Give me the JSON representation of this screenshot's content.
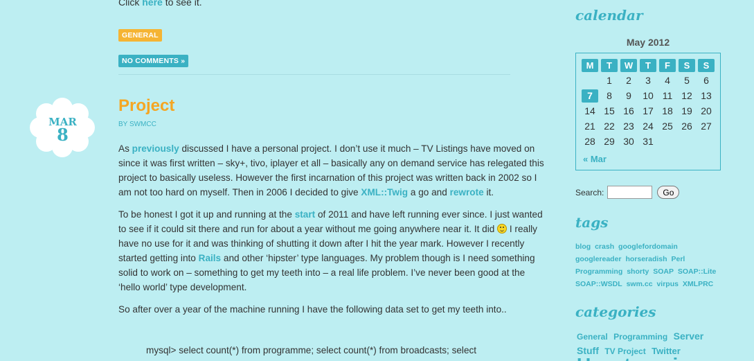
{
  "previous_post": {
    "click_prefix": "Click",
    "click_link": "here",
    "click_suffix": "to see it.",
    "category": "GENERAL",
    "comments": "NO COMMENTS »"
  },
  "post": {
    "date_month": "MAR",
    "date_day": "8",
    "title": "Project",
    "byline": "BY SWMCC",
    "p1": {
      "t1": "As",
      "l1": "previously",
      "t2": "discussed I have a personal project. I don’t use it much – TV Listings have moved on since it was first written – sky+, tivo, iplayer et all – basically any on demand service has relegated this project to basically useless. However the first incarnation of this project was written back in 2002 so I am not too hard on myself. Then in 2006 I decided to give",
      "l2": "XML::Twig",
      "t3": "a go and",
      "l3": "rewrote",
      "t4": "it."
    },
    "p2": {
      "t1": "To be honest I got it up and running at the",
      "l1": "start",
      "t2": "of 2011 and have left running ever since. I just wanted to see if it could sit there and run for about a year without me going anywhere near it. It did",
      "t3": "I really have no use for it and was thinking of shutting it down after I hit the year mark. However I recently started getting into",
      "l2": "Rails",
      "t4": "and other ‘hipster’ type languages. My problem though is I need something solid to work on – something to get my teeth into – a real life problem. I’ve never been good at the ‘hello world’ type development."
    },
    "p3": "So after over a year of the machine running I have the following data set to get my teeth into..",
    "code": "mysql> select count(*) from programme; select count(*) from broadcasts; select"
  },
  "sidebar": {
    "calendar_heading": "calendar",
    "calendar_caption": "May 2012",
    "weekdays": [
      "M",
      "T",
      "W",
      "T",
      "F",
      "S",
      "S"
    ],
    "weeks": [
      [
        "",
        "1",
        "2",
        "3",
        "4",
        "5",
        "6"
      ],
      [
        "7",
        "8",
        "9",
        "10",
        "11",
        "12",
        "13"
      ],
      [
        "14",
        "15",
        "16",
        "17",
        "18",
        "19",
        "20"
      ],
      [
        "21",
        "22",
        "23",
        "24",
        "25",
        "26",
        "27"
      ],
      [
        "28",
        "29",
        "30",
        "31",
        "",
        "",
        ""
      ]
    ],
    "today": "7",
    "prev_month": "« Mar",
    "search_label": "Search:",
    "search_button": "Go",
    "tags_heading": "tags",
    "tags": [
      "blog",
      "crash",
      "googlefordomain",
      "googlereader",
      "horseradish",
      "Perl",
      "Programming",
      "shorty",
      "SOAP",
      "SOAP::Lite",
      "SOAP::WSDL",
      "swm.cc",
      "virpus",
      "XMLPRC"
    ],
    "categories_heading": "categories",
    "categories": [
      {
        "label": "General",
        "size": 12
      },
      {
        "label": "Programming",
        "size": 12
      },
      {
        "label": "Server",
        "size": 14
      },
      {
        "label": "Stuff",
        "size": 14
      },
      {
        "label": "TV Project",
        "size": 12
      },
      {
        "label": "Twitter",
        "size": 13
      },
      {
        "label": "Uncategorize",
        "size": 28
      }
    ]
  },
  "colors": {
    "background": "#bdeef2",
    "accent": "#3ab1c3",
    "title": "#f5a623",
    "category_badge": "#f5b434"
  }
}
